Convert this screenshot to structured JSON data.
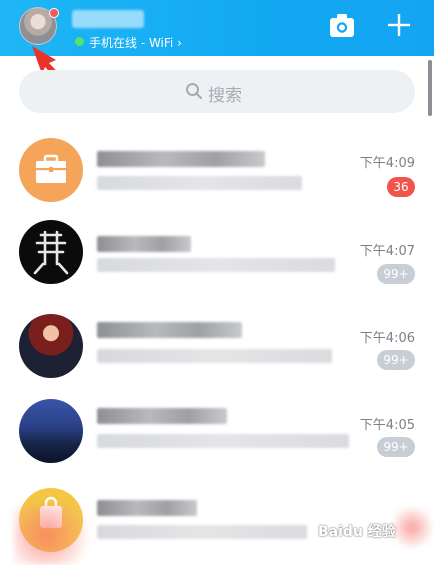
{
  "header": {
    "status_text": "手机在线 - WiFi",
    "status_chevron": "›",
    "icons": [
      "camera-icon",
      "plus-icon"
    ],
    "accent": "#14a5f2"
  },
  "search": {
    "placeholder": "搜索",
    "icon": "search-icon"
  },
  "chats": [
    {
      "time": "下午4:09",
      "badge": "36",
      "badge_color": "#f2544c"
    },
    {
      "time": "下午4:07",
      "badge": "99+",
      "badge_color": "#c8ced6"
    },
    {
      "time": "下午4:06",
      "badge": "99+",
      "badge_color": "#c8ced6"
    },
    {
      "time": "下午4:05",
      "badge": "99+",
      "badge_color": "#c8ced6"
    },
    {
      "time": "",
      "badge": ""
    }
  ],
  "watermark": "Baidu 经验",
  "annotation": {
    "color": "#e8322a",
    "points_to": "avatar"
  }
}
